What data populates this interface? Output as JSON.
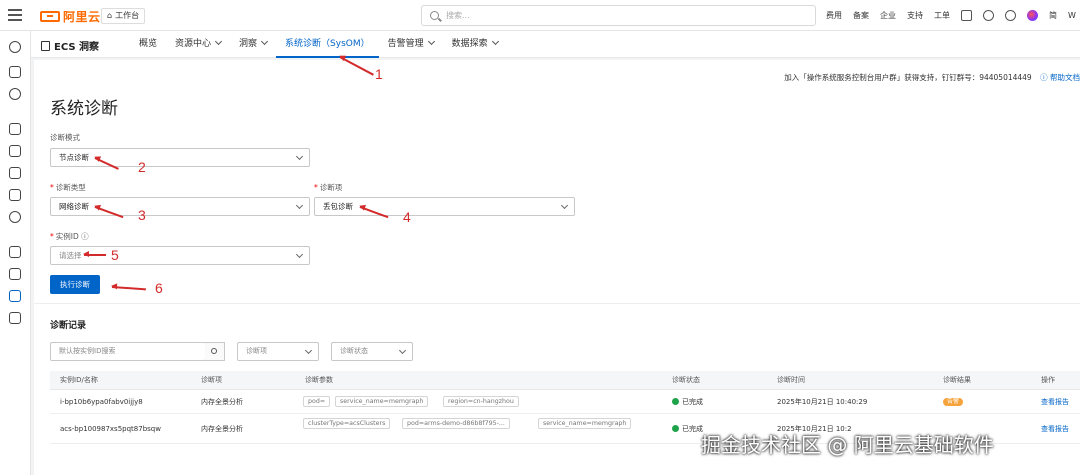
{
  "topbar": {
    "logo_text": "阿里云",
    "workbench": "工作台",
    "search_placeholder": "搜索...",
    "nav": [
      "费用",
      "备案",
      "企业",
      "支持",
      "工单"
    ],
    "lang": "简",
    "user_initial": "W"
  },
  "subnav": {
    "brand": "ECS 洞察",
    "tabs": [
      {
        "label": "概览",
        "dropdown": false
      },
      {
        "label": "资源中心",
        "dropdown": true
      },
      {
        "label": "洞察",
        "dropdown": true
      },
      {
        "label": "系统诊断（SysOM）",
        "dropdown": false,
        "active": true
      },
      {
        "label": "告警管理",
        "dropdown": true
      },
      {
        "label": "数据探索",
        "dropdown": true
      }
    ]
  },
  "main": {
    "help_text": "加入「操作系统服务控制台用户群」获得支持，钉钉群号：94405014449",
    "help_link": "帮助文档",
    "title": "系统诊断",
    "mode_label": "诊断模式",
    "mode_value": "节点诊断",
    "type_label": "诊断类型",
    "type_value": "网络诊断",
    "item_label": "诊断项",
    "item_value": "丢包诊断",
    "instance_label": "实例ID",
    "instance_placeholder": "请选择",
    "run_button": "执行诊断",
    "records_title": "诊断记录",
    "filter_search_placeholder": "默认按实例ID搜索",
    "filter_item": "诊断项",
    "filter_status": "诊断状态"
  },
  "table": {
    "headers": [
      "实例ID/名称",
      "诊断项",
      "诊断参数",
      "诊断状态",
      "诊断时间",
      "诊断结果",
      "操作"
    ],
    "rows": [
      {
        "instance": "i-bp10b6ypa0fabv0ijjy8",
        "item": "内存全景分析",
        "params": [
          "pod=",
          "service_name=memgraph",
          "region=cn-hangzhou"
        ],
        "status": "已完成",
        "time": "2025年10月21日 10:40:29",
        "result": "告警",
        "action": "查看报告"
      },
      {
        "instance": "acs-bp100987xs5pqt87bsqw",
        "item": "内存全景分析",
        "params": [
          "clusterType=acsClusters",
          "pod=arms-demo-d86b8f795-...",
          "service_name=memgraph"
        ],
        "status": "已完成",
        "time": "2025年10月21日 10:2",
        "result": "",
        "action": "查看报告"
      }
    ]
  },
  "annotations": [
    "1",
    "2",
    "3",
    "4",
    "5",
    "6"
  ],
  "watermark": "掘金技术社区 @ 阿里云基础软件",
  "colors": {
    "brand_orange": "#ff6a00",
    "primary_blue": "#0064c8",
    "annotation_red": "#d32b2b",
    "success_green": "#1fa34a"
  }
}
